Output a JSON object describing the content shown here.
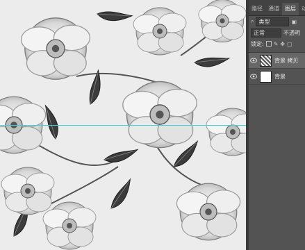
{
  "panel": {
    "tabs": [
      {
        "label": "路径"
      },
      {
        "label": "通道"
      },
      {
        "label": "图层"
      },
      {
        "label": "动作"
      }
    ],
    "filter": {
      "kind_label": "类型"
    },
    "blend_mode": {
      "value": "正常",
      "opacity_label": "不透明"
    },
    "lock_label": "锁定:",
    "layers": [
      {
        "name": "背景 拷贝",
        "thumbnail": "pattern",
        "selected": true
      },
      {
        "name": "背景",
        "thumbnail": "white",
        "selected": false
      }
    ]
  },
  "colors": {
    "guide": "#2fd8e0",
    "panel_bg": "#535353",
    "selected_layer": "#676767"
  }
}
